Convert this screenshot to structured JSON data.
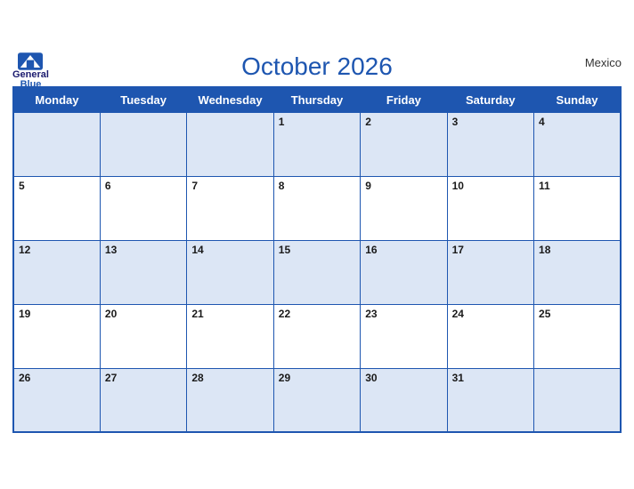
{
  "header": {
    "logo": {
      "general": "General",
      "blue": "Blue"
    },
    "title": "October 2026",
    "country": "Mexico"
  },
  "weekdays": [
    "Monday",
    "Tuesday",
    "Wednesday",
    "Thursday",
    "Friday",
    "Saturday",
    "Sunday"
  ],
  "weeks": [
    [
      null,
      null,
      null,
      1,
      2,
      3,
      4
    ],
    [
      5,
      6,
      7,
      8,
      9,
      10,
      11
    ],
    [
      12,
      13,
      14,
      15,
      16,
      17,
      18
    ],
    [
      19,
      20,
      21,
      22,
      23,
      24,
      25
    ],
    [
      26,
      27,
      28,
      29,
      30,
      31,
      null
    ]
  ]
}
